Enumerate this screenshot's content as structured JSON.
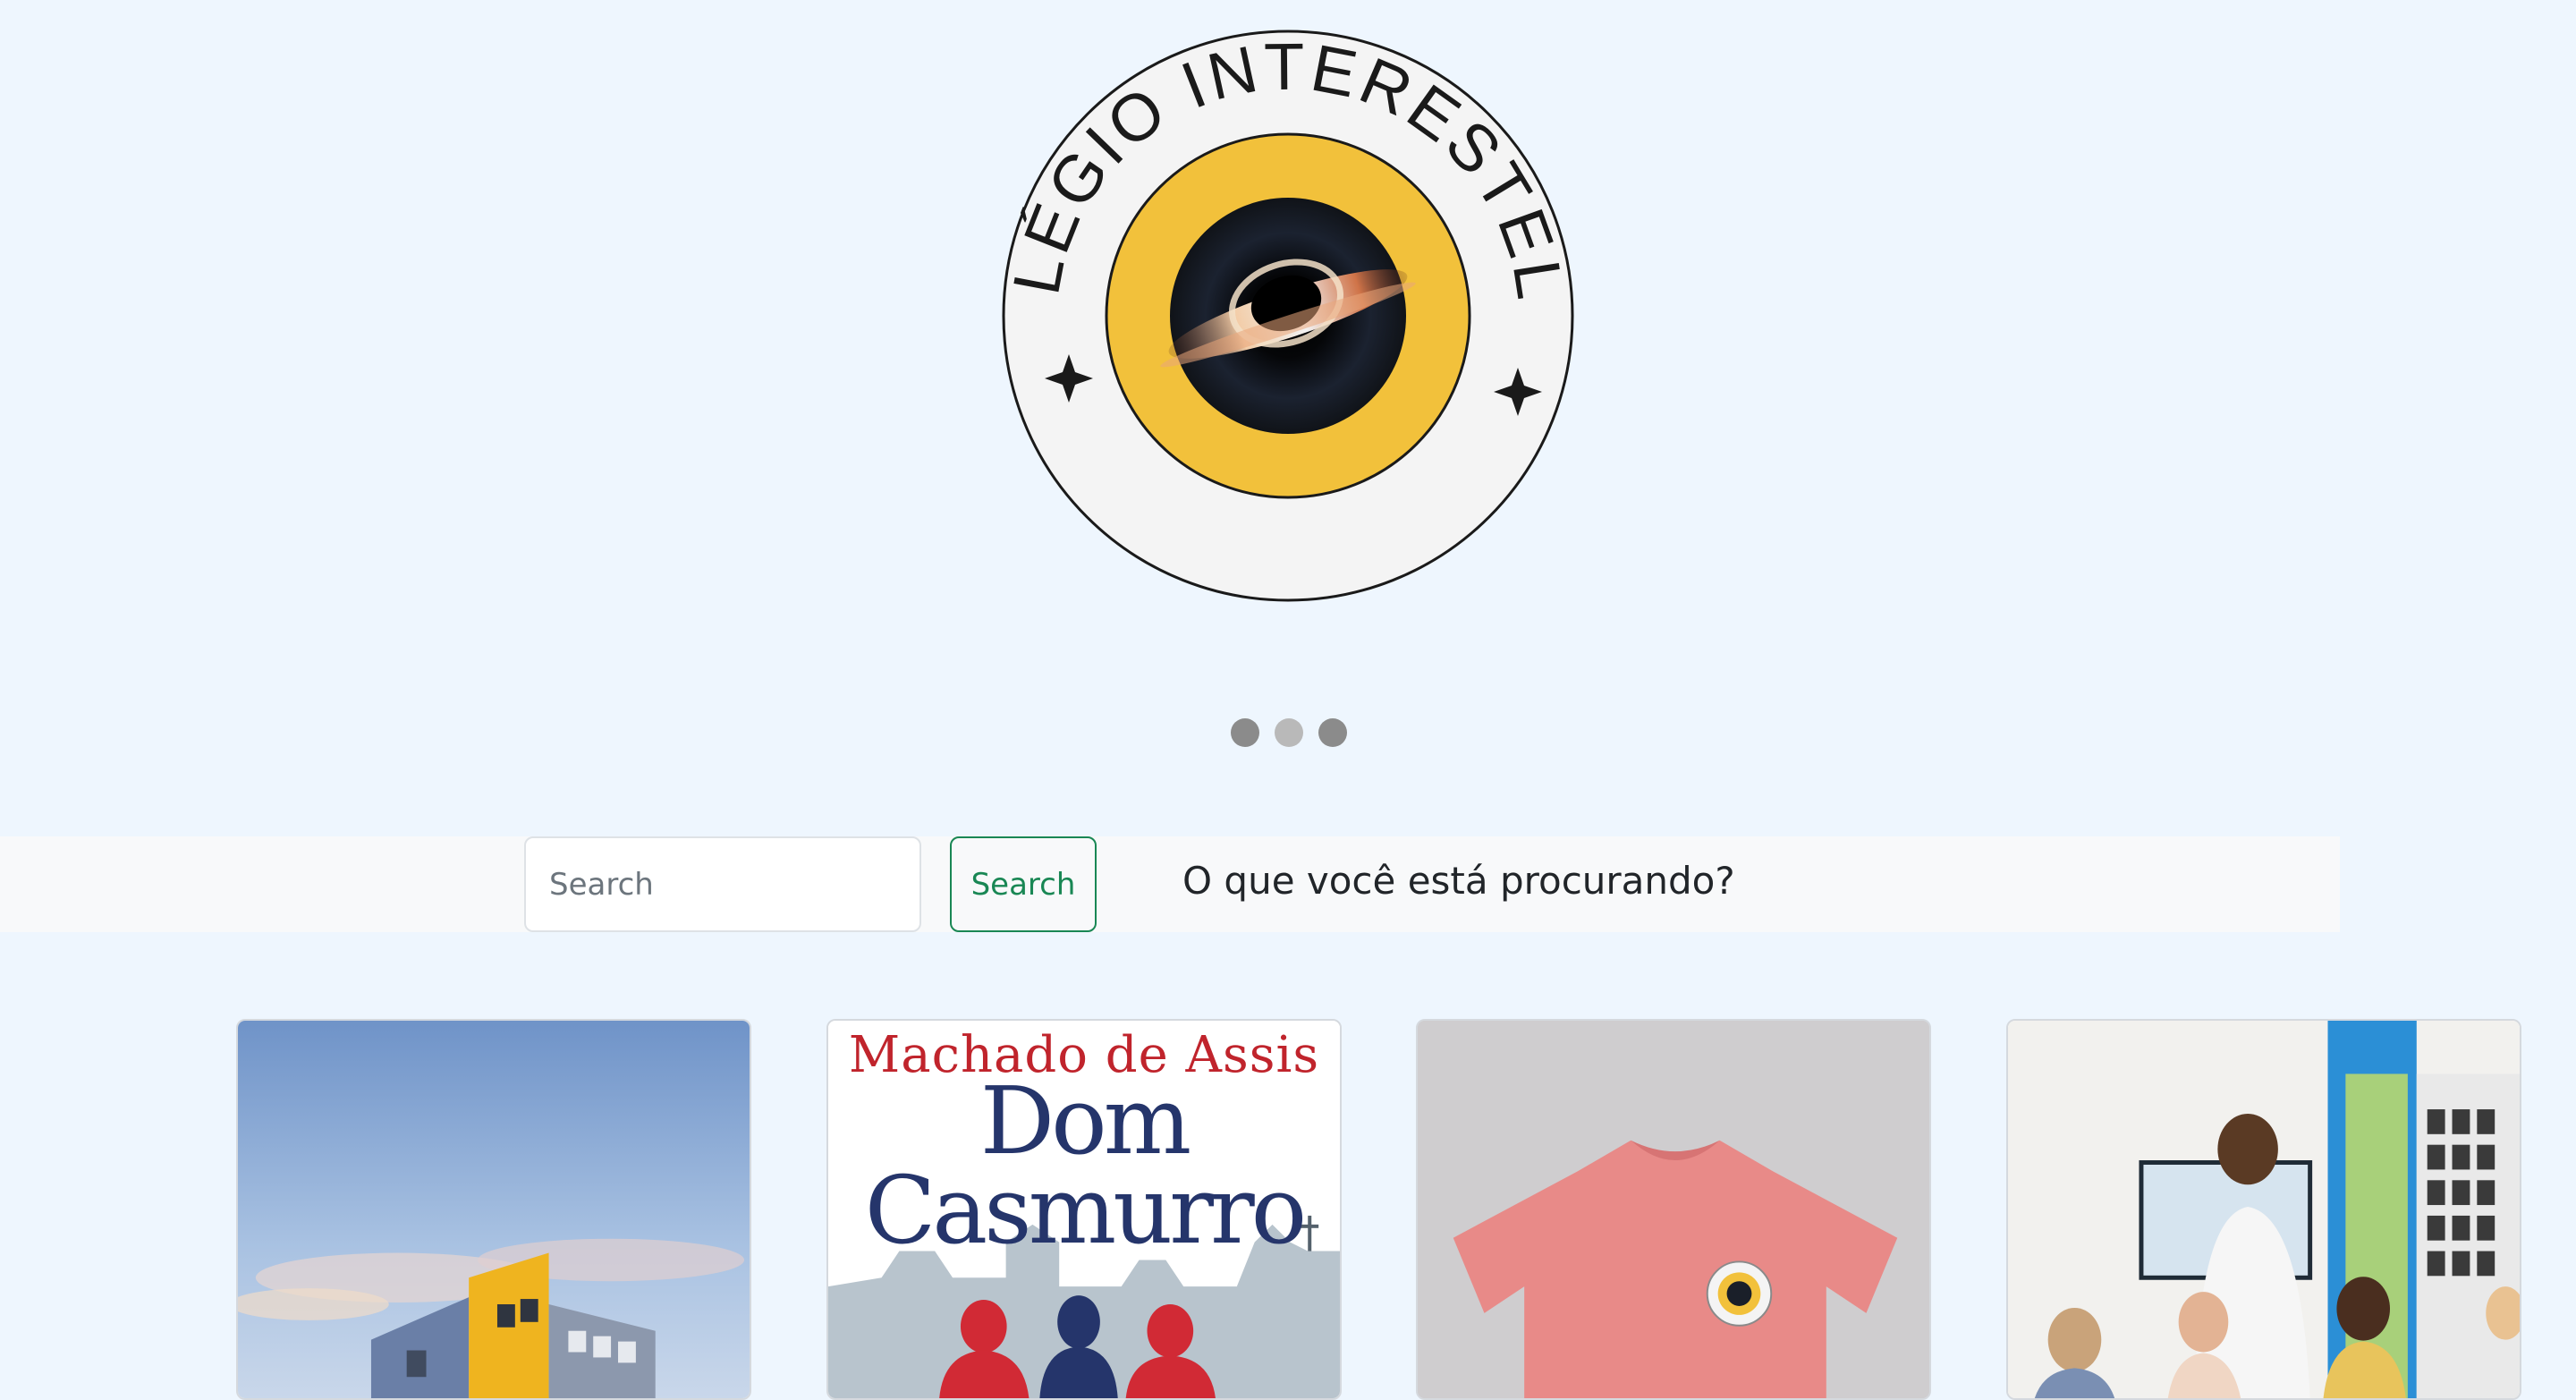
{
  "logo": {
    "ring_text": "COLÉGIO INTERESTELAR",
    "colors": {
      "ring_fill": "#f4f4f4",
      "ring_stroke": "#1a1a1a",
      "gold": "#f2c13b",
      "core": "#141820"
    }
  },
  "carousel": {
    "slide_count": 3,
    "active_index": 0
  },
  "search": {
    "placeholder": "Search",
    "value": "",
    "button_label": "Search",
    "prompt": "O que você está procurando?"
  },
  "cards": {
    "building": {
      "image": "school-building-photo"
    },
    "book": {
      "author": "Machado de Assis",
      "title": "Dom\nCasmurro",
      "accent": "#c0242c",
      "title_color": "#25356b"
    },
    "shirt": {
      "image": "pink-school-t-shirt",
      "color": "#e88a88"
    },
    "classroom": {
      "image": "classroom-teacher-students-photo"
    }
  },
  "colors": {
    "page_bg": "#eef6fe",
    "search_bar_bg": "#f8f9fa",
    "success": "#198754"
  }
}
